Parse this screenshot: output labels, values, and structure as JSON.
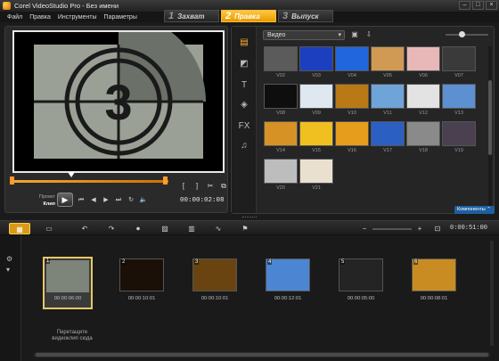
{
  "window": {
    "title": "Corel VideoStudio Pro - Без имени"
  },
  "menu": [
    "Файл",
    "Правка",
    "Инструменты",
    "Параметры"
  ],
  "steps": [
    {
      "num": "1",
      "label": "Захват",
      "active": false
    },
    {
      "num": "2",
      "label": "Правка",
      "active": true
    },
    {
      "num": "3",
      "label": "Выпуск",
      "active": false
    }
  ],
  "player": {
    "project_label": "Проект",
    "clip_label": "Клип",
    "timecode": "00:00:02:08",
    "countdown_digit": "3",
    "progress": 1.0
  },
  "library": {
    "category": "Видео",
    "components_label": "Компоненты",
    "thumbs": [
      {
        "label": "V02",
        "color": "#5b5b5b"
      },
      {
        "label": "V03",
        "color": "#1c3fbf"
      },
      {
        "label": "V04",
        "color": "#2266dd"
      },
      {
        "label": "V05",
        "color": "#d09a55"
      },
      {
        "label": "V06",
        "color": "#e8b8b8"
      },
      {
        "label": "V07",
        "color": "#3a3a3a"
      },
      {
        "label": "V08",
        "color": "#0e0e0e"
      },
      {
        "label": "V09",
        "color": "#dfe7f0"
      },
      {
        "label": "V10",
        "color": "#b97a15"
      },
      {
        "label": "V11",
        "color": "#6fa4d8"
      },
      {
        "label": "V12",
        "color": "#e3e3e3"
      },
      {
        "label": "V13",
        "color": "#5c90d0"
      },
      {
        "label": "V14",
        "color": "#d69225"
      },
      {
        "label": "V15",
        "color": "#f0c020"
      },
      {
        "label": "V16",
        "color": "#e59d1b"
      },
      {
        "label": "V17",
        "color": "#2c5fc2"
      },
      {
        "label": "V18",
        "color": "#8a8a8a"
      },
      {
        "label": "V19",
        "color": "#4a4050"
      },
      {
        "label": "V20",
        "color": "#bdbdbd"
      },
      {
        "label": "V21",
        "color": "#e9e0d0"
      }
    ]
  },
  "storyboard": {
    "clips": [
      {
        "num": "1",
        "time": "00:00:06:00",
        "color": "#7d847a"
      },
      {
        "num": "2",
        "time": "00:00:10:01",
        "color": "#1a1008"
      },
      {
        "num": "3",
        "time": "00:00:10:01",
        "color": "#6a4410"
      },
      {
        "num": "4",
        "time": "00:00:12:01",
        "color": "#4c86d3"
      },
      {
        "num": "5",
        "time": "00:00:05:00",
        "color": "#242424"
      },
      {
        "num": "6",
        "time": "00:00:08:01",
        "color": "#c88c23"
      }
    ],
    "drop_hint": "Перетащите видеоклип сюда",
    "total_time": "0:00:51:00"
  }
}
